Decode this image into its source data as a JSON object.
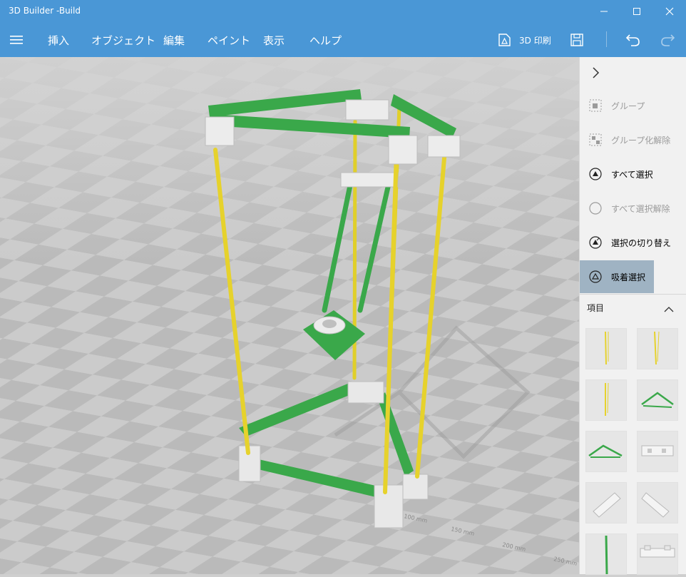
{
  "window": {
    "title": "3D Builder -Build"
  },
  "menu": {
    "items": [
      "挿入",
      "オブジェクト",
      "編集",
      "ペイント",
      "表示",
      "ヘルプ"
    ],
    "print_label": "3D 印刷"
  },
  "panel": {
    "commands": [
      {
        "label": "グループ",
        "enabled": false,
        "selected": false
      },
      {
        "label": "グループ化解除",
        "enabled": false,
        "selected": false
      },
      {
        "label": "すべて選択",
        "enabled": true,
        "selected": false
      },
      {
        "label": "すべて選択解除",
        "enabled": false,
        "selected": false
      },
      {
        "label": "選択の切り替え",
        "enabled": true,
        "selected": false
      },
      {
        "label": "吸着選択",
        "enabled": true,
        "selected": true
      }
    ],
    "items_header": "項目"
  },
  "ruler": {
    "labels": [
      "100 mm",
      "150 mm",
      "200 mm",
      "250 mm"
    ]
  },
  "colors": {
    "accent": "#4a97d6",
    "frame_green": "#3aa84a",
    "rod_yellow": "#e6d22c",
    "selected_bg": "#9fb3c3"
  }
}
